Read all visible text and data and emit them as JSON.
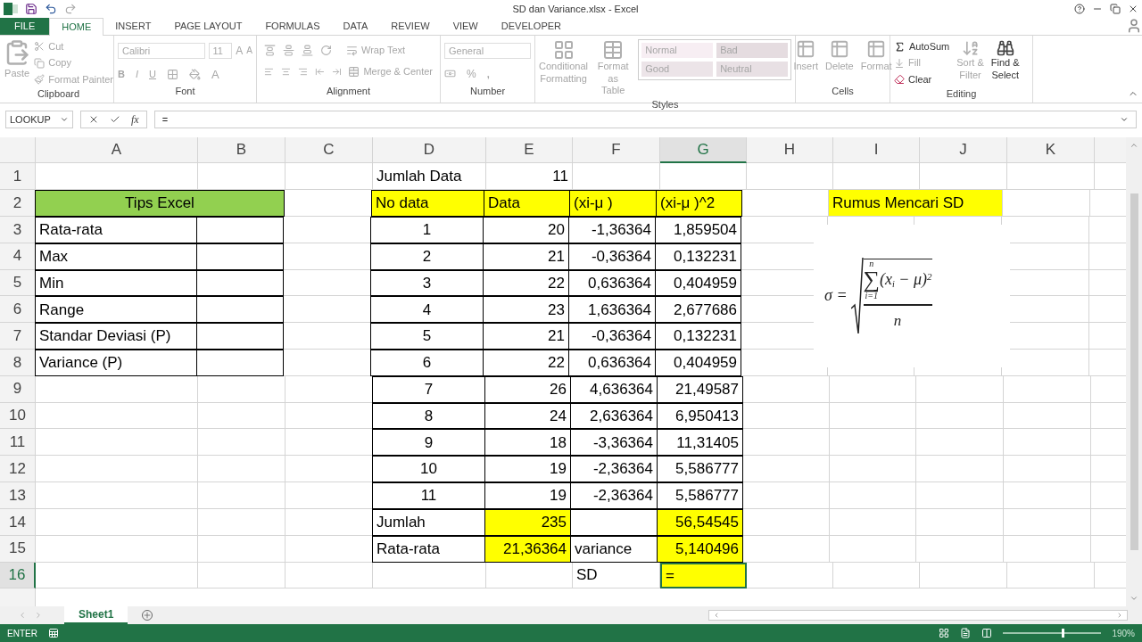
{
  "window": {
    "title": "SD dan Variance.xlsx - Excel"
  },
  "tabs": [
    {
      "label": "FILE",
      "kind": "file",
      "selected": false
    },
    {
      "label": "HOME",
      "kind": "tab",
      "selected": true
    },
    {
      "label": "INSERT",
      "kind": "tab",
      "selected": false
    },
    {
      "label": "PAGE LAYOUT",
      "kind": "tab",
      "selected": false
    },
    {
      "label": "FORMULAS",
      "kind": "tab",
      "selected": false
    },
    {
      "label": "DATA",
      "kind": "tab",
      "selected": false
    },
    {
      "label": "REVIEW",
      "kind": "tab",
      "selected": false
    },
    {
      "label": "VIEW",
      "kind": "tab",
      "selected": false
    },
    {
      "label": "DEVELOPER",
      "kind": "tab",
      "selected": false
    }
  ],
  "ribbon": {
    "disabled": true,
    "clipboard": {
      "paste": "Paste",
      "cut": "Cut",
      "copy": "Copy",
      "format_painter": "Format Painter",
      "label": "Clipboard"
    },
    "font": {
      "font_name": "Calibri",
      "font_size": "11",
      "bold": "B",
      "italic": "I",
      "underline": "U",
      "grow": "A",
      "shrink": "A",
      "font_color": "A",
      "label": "Font"
    },
    "alignment": {
      "wrap": "Wrap Text",
      "merge": "Merge & Center",
      "label": "Alignment"
    },
    "number": {
      "format": "General",
      "percent": "%",
      "comma": ",",
      "label": "Number"
    },
    "styles": {
      "conditional": [
        "Conditional",
        "Formatting"
      ],
      "format_table": [
        "Format as",
        "Table"
      ],
      "gallery": [
        {
          "label": "Normal",
          "color": "#f7eef3"
        },
        {
          "label": "Bad",
          "color": "#e5dce0"
        },
        {
          "label": "Good",
          "color": "#ece4e8"
        },
        {
          "label": "Neutral",
          "color": "#e8e0e4"
        }
      ],
      "label": "Styles"
    },
    "cells": {
      "buttons": [
        "Insert",
        "Delete",
        "Format"
      ],
      "label": "Cells"
    },
    "editing": {
      "autosum": "AutoSum",
      "fill": "Fill",
      "clear": "Clear",
      "sort": [
        "Sort &",
        "Filter"
      ],
      "find": [
        "Find &",
        "Select"
      ],
      "label": "Editing"
    }
  },
  "formula_bar": {
    "name_box": "LOOKUP",
    "fx": "fx",
    "value": "="
  },
  "sheet": {
    "columns": [
      {
        "label": "A",
        "selected": false
      },
      {
        "label": "B",
        "selected": false
      },
      {
        "label": "C",
        "selected": false
      },
      {
        "label": "D",
        "selected": false
      },
      {
        "label": "E",
        "selected": false
      },
      {
        "label": "F",
        "selected": false
      },
      {
        "label": "G",
        "selected": true
      },
      {
        "label": "H",
        "selected": false
      },
      {
        "label": "I",
        "selected": false
      },
      {
        "label": "J",
        "selected": false
      },
      {
        "label": "K",
        "selected": false
      }
    ],
    "rows": [
      {
        "label": "1",
        "selected": false,
        "cells": [
          {},
          {},
          {},
          {
            "text": "Jumlah Data",
            "kind": "text"
          },
          {
            "text": "11",
            "kind": "number"
          }
        ]
      },
      {
        "label": "2",
        "selected": false,
        "cells": [
          {
            "text": "Tips Excel",
            "kind": "heading",
            "merged": true,
            "color": "#92d050",
            "bordered": true
          },
          {},
          {},
          {
            "text": "No data",
            "kind": "text",
            "color": "#ffff00",
            "bordered": true
          },
          {
            "text": "Data",
            "kind": "text",
            "color": "#ffff00",
            "bordered": true
          },
          {
            "text": "(xi-μ  )",
            "kind": "text",
            "color": "#ffff00",
            "bordered": true
          },
          {
            "text": "(xi-μ  )^2",
            "kind": "text",
            "color": "#ffff00",
            "bordered": true
          },
          {},
          {
            "text": "Rumus Mencari SD",
            "kind": "text",
            "merged": true,
            "color": "#ffff00"
          },
          {}
        ]
      },
      {
        "label": "3",
        "selected": false,
        "cells": [
          {
            "text": "Rata-rata",
            "kind": "text",
            "bordered": true
          },
          {
            "kind": "blank",
            "bordered": true
          },
          {},
          {
            "text": "1",
            "kind": "index",
            "bordered": true
          },
          {
            "text": "20",
            "kind": "number",
            "bordered": true
          },
          {
            "text": "-1,36364",
            "kind": "number",
            "bordered": true
          },
          {
            "text": "1,859504",
            "kind": "number",
            "bordered": true
          }
        ]
      },
      {
        "label": "4",
        "selected": false,
        "cells": [
          {
            "text": "Max",
            "kind": "text",
            "bordered": true
          },
          {
            "kind": "blank",
            "bordered": true
          },
          {},
          {
            "text": "2",
            "kind": "index",
            "bordered": true
          },
          {
            "text": "21",
            "kind": "number",
            "bordered": true
          },
          {
            "text": "-0,36364",
            "kind": "number",
            "bordered": true
          },
          {
            "text": "0,132231",
            "kind": "number",
            "bordered": true
          }
        ]
      },
      {
        "label": "5",
        "selected": false,
        "cells": [
          {
            "text": "Min",
            "kind": "text",
            "bordered": true
          },
          {
            "kind": "blank",
            "bordered": true
          },
          {},
          {
            "text": "3",
            "kind": "index",
            "bordered": true
          },
          {
            "text": "22",
            "kind": "number",
            "bordered": true
          },
          {
            "text": "0,636364",
            "kind": "number",
            "bordered": true
          },
          {
            "text": "0,404959",
            "kind": "number",
            "bordered": true
          }
        ]
      },
      {
        "label": "6",
        "selected": false,
        "cells": [
          {
            "text": "Range",
            "kind": "text",
            "bordered": true
          },
          {
            "kind": "blank",
            "bordered": true
          },
          {},
          {
            "text": "4",
            "kind": "index",
            "bordered": true
          },
          {
            "text": "23",
            "kind": "number",
            "bordered": true
          },
          {
            "text": "1,636364",
            "kind": "number",
            "bordered": true
          },
          {
            "text": "2,677686",
            "kind": "number",
            "bordered": true
          }
        ]
      },
      {
        "label": "7",
        "selected": false,
        "cells": [
          {
            "text": "Standar Deviasi (P)",
            "kind": "text",
            "bordered": true
          },
          {
            "kind": "blank",
            "bordered": true
          },
          {},
          {
            "text": "5",
            "kind": "index",
            "bordered": true
          },
          {
            "text": "21",
            "kind": "number",
            "bordered": true
          },
          {
            "text": "-0,36364",
            "kind": "number",
            "bordered": true
          },
          {
            "text": "0,132231",
            "kind": "number",
            "bordered": true
          }
        ]
      },
      {
        "label": "8",
        "selected": false,
        "cells": [
          {
            "text": "Variance (P)",
            "kind": "text",
            "bordered": true
          },
          {
            "kind": "blank",
            "bordered": true
          },
          {},
          {
            "text": "6",
            "kind": "index",
            "bordered": true
          },
          {
            "text": "22",
            "kind": "number",
            "bordered": true
          },
          {
            "text": "0,636364",
            "kind": "number",
            "bordered": true
          },
          {
            "text": "0,404959",
            "kind": "number",
            "bordered": true
          }
        ]
      },
      {
        "label": "9",
        "selected": false,
        "cells": [
          {},
          {},
          {},
          {
            "text": "7",
            "kind": "index",
            "bordered": true
          },
          {
            "text": "26",
            "kind": "number",
            "bordered": true
          },
          {
            "text": "4,636364",
            "kind": "number",
            "bordered": true
          },
          {
            "text": "21,49587",
            "kind": "number",
            "bordered": true
          }
        ]
      },
      {
        "label": "10",
        "selected": false,
        "cells": [
          {},
          {},
          {},
          {
            "text": "8",
            "kind": "index",
            "bordered": true
          },
          {
            "text": "24",
            "kind": "number",
            "bordered": true
          },
          {
            "text": "2,636364",
            "kind": "number",
            "bordered": true
          },
          {
            "text": "6,950413",
            "kind": "number",
            "bordered": true
          }
        ]
      },
      {
        "label": "11",
        "selected": false,
        "cells": [
          {},
          {},
          {},
          {
            "text": "9",
            "kind": "index",
            "bordered": true
          },
          {
            "text": "18",
            "kind": "number",
            "bordered": true
          },
          {
            "text": "-3,36364",
            "kind": "number",
            "bordered": true
          },
          {
            "text": "11,31405",
            "kind": "number",
            "bordered": true
          }
        ]
      },
      {
        "label": "12",
        "selected": false,
        "cells": [
          {},
          {},
          {},
          {
            "text": "10",
            "kind": "index",
            "bordered": true
          },
          {
            "text": "19",
            "kind": "number",
            "bordered": true
          },
          {
            "text": "-2,36364",
            "kind": "number",
            "bordered": true
          },
          {
            "text": "5,586777",
            "kind": "number",
            "bordered": true
          }
        ]
      },
      {
        "label": "13",
        "selected": false,
        "cells": [
          {},
          {},
          {},
          {
            "text": "11",
            "kind": "index",
            "bordered": true
          },
          {
            "text": "19",
            "kind": "number",
            "bordered": true
          },
          {
            "text": "-2,36364",
            "kind": "number",
            "bordered": true
          },
          {
            "text": "5,586777",
            "kind": "number",
            "bordered": true
          }
        ]
      },
      {
        "label": "14",
        "selected": false,
        "cells": [
          {},
          {},
          {},
          {
            "text": "Jumlah",
            "kind": "text",
            "bordered": true
          },
          {
            "text": "235",
            "kind": "number",
            "color": "#ffff00",
            "bordered": true
          },
          {
            "kind": "blank",
            "bordered": true
          },
          {
            "text": "56,54545",
            "kind": "number",
            "color": "#ffff00",
            "bordered": true
          }
        ]
      },
      {
        "label": "15",
        "selected": false,
        "cells": [
          {},
          {},
          {},
          {
            "text": "Rata-rata",
            "kind": "text",
            "bordered": true
          },
          {
            "text": "21,36364",
            "kind": "number",
            "color": "#ffff00",
            "bordered": true
          },
          {
            "text": "variance",
            "kind": "text",
            "bordered": true
          },
          {
            "text": "5,140496",
            "kind": "number",
            "color": "#ffff00",
            "bordered": true
          }
        ]
      },
      {
        "label": "16",
        "selected": true,
        "cells": [
          {},
          {},
          {},
          {},
          {},
          {
            "text": "SD",
            "kind": "text"
          },
          {
            "text": "=",
            "kind": "text",
            "color": "#ffff00"
          }
        ]
      }
    ],
    "formula_image": {
      "lhs": "σ =",
      "sum": "∑",
      "sum_top": "n",
      "sum_bottom": "i=1",
      "term": "(x",
      "sub": "i",
      "term_rest": " − μ)",
      "sup": "2",
      "denominator": "n"
    }
  },
  "sheet_tabs": [
    {
      "label": "Sheet1",
      "selected": true
    }
  ],
  "status_bar": {
    "mode": "ENTER",
    "zoom": "190%",
    "zoom_slider": {
      "level": 0.6
    }
  }
}
